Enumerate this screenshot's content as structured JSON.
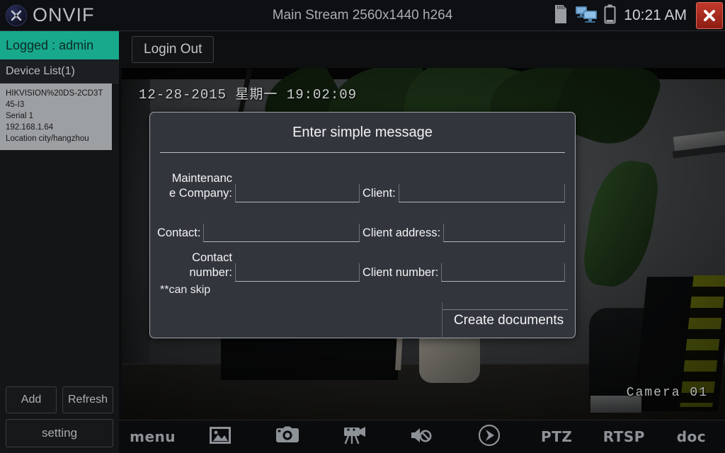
{
  "titlebar": {
    "app_name": "ONVIF",
    "logo_icon": "onvif-wrench-icon",
    "stream_info": "Main Stream 2560x1440 h264",
    "sd_icon": "sd-card-icon",
    "network_icon": "network-monitors-icon",
    "battery_icon": "battery-icon",
    "clock": "10:21 AM",
    "close_icon": "close-x-icon"
  },
  "sidebar": {
    "logged_label": "Logged : admin",
    "device_list_header": "Device List(1)",
    "devices": [
      {
        "name": "HIKVISION%20DS-2CD3T",
        "name_cont": "45-I3",
        "serial": "Serial  1",
        "ip": "192.168.1.64",
        "location": "Location  city/hangzhou"
      }
    ],
    "add_label": "Add",
    "refresh_label": "Refresh",
    "setting_label": "setting"
  },
  "topbar": {
    "logout_label": "Login Out"
  },
  "video": {
    "osd_datetime": "12-28-2015  星期一  19:02:09",
    "osd_camera": "Camera  01"
  },
  "dialog": {
    "title": "Enter simple message",
    "fields_left": [
      {
        "label": "Maintenanc\ne Company:",
        "value": "",
        "placeholder": ""
      },
      {
        "label": "Contact:",
        "value": "",
        "placeholder": ""
      },
      {
        "label": "Contact\nnumber:",
        "value": "",
        "placeholder": ""
      }
    ],
    "fields_right": [
      {
        "label": "Client:",
        "value": "",
        "placeholder": ""
      },
      {
        "label": "Client address:",
        "value": "",
        "placeholder": ""
      },
      {
        "label": "Client number:",
        "value": "",
        "placeholder": ""
      }
    ],
    "note": "**can skip",
    "submit_label": "Create documents"
  },
  "toolbar": {
    "items": [
      {
        "label": "menu",
        "icon": "menu-text-icon",
        "type": "text"
      },
      {
        "label": "",
        "icon": "image-gallery-icon",
        "type": "icon"
      },
      {
        "label": "",
        "icon": "camera-snapshot-icon",
        "type": "icon"
      },
      {
        "label": "",
        "icon": "video-record-icon",
        "type": "icon"
      },
      {
        "label": "",
        "icon": "speaker-muted-icon",
        "type": "icon"
      },
      {
        "label": "",
        "icon": "play-circle-icon",
        "type": "icon"
      },
      {
        "label": "PTZ",
        "icon": "ptz-text-icon",
        "type": "text"
      },
      {
        "label": "RTSP",
        "icon": "rtsp-text-icon",
        "type": "text"
      },
      {
        "label": "doc",
        "icon": "doc-text-icon",
        "type": "text"
      }
    ]
  },
  "colors": {
    "accent_teal": "#18a88c",
    "close_red": "#c0392b",
    "dialog_bg": "#32363c",
    "sidebar_bg": "#141517"
  }
}
